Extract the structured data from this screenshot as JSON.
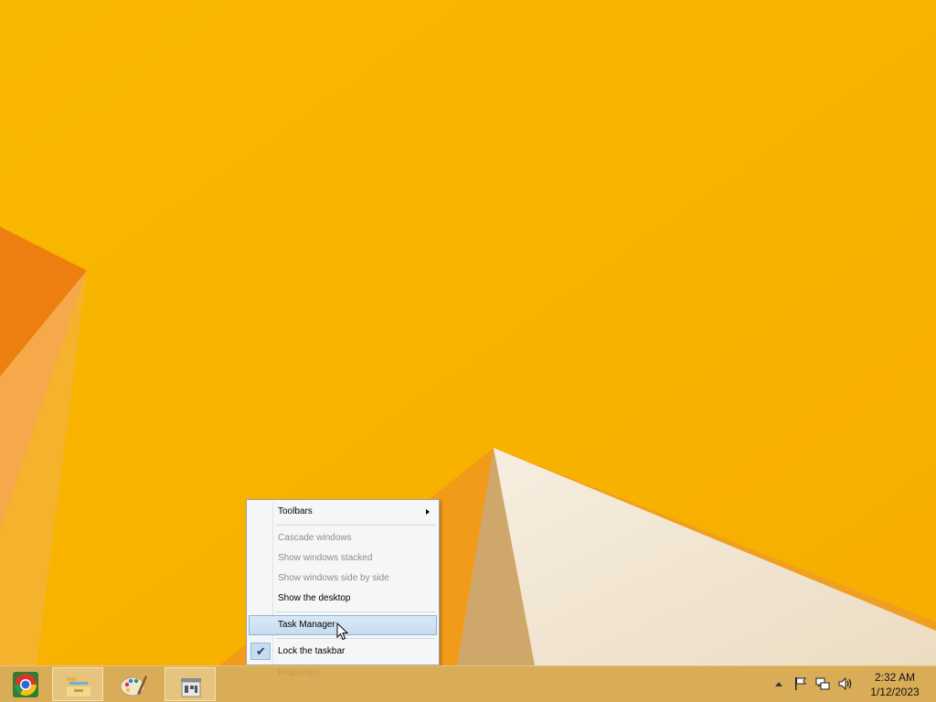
{
  "context_menu": {
    "items": [
      {
        "label": "Toolbars"
      },
      {
        "label": "Cascade windows"
      },
      {
        "label": "Show windows stacked"
      },
      {
        "label": "Show windows side by side"
      },
      {
        "label": "Show the desktop"
      },
      {
        "label": "Task Manager"
      },
      {
        "label": "Lock the taskbar"
      },
      {
        "label": "Properties"
      }
    ],
    "checkmark": "✔"
  },
  "taskbar": {
    "pinned": [
      {
        "icon": "chrome-icon"
      },
      {
        "icon": "file-explorer-icon"
      },
      {
        "icon": "paint-icon"
      },
      {
        "icon": "store-icon"
      }
    ],
    "tray_icons": [
      "show-hidden-icons-arrow",
      "action-center-flag-icon",
      "network-icon",
      "volume-icon"
    ],
    "clock": {
      "time": "2:32 AM",
      "date": "1/12/2023"
    }
  },
  "colors": {
    "wallpaper": "#f7b500",
    "taskbar": "#d9ad58",
    "menu_highlight": "#c7dcf1"
  }
}
